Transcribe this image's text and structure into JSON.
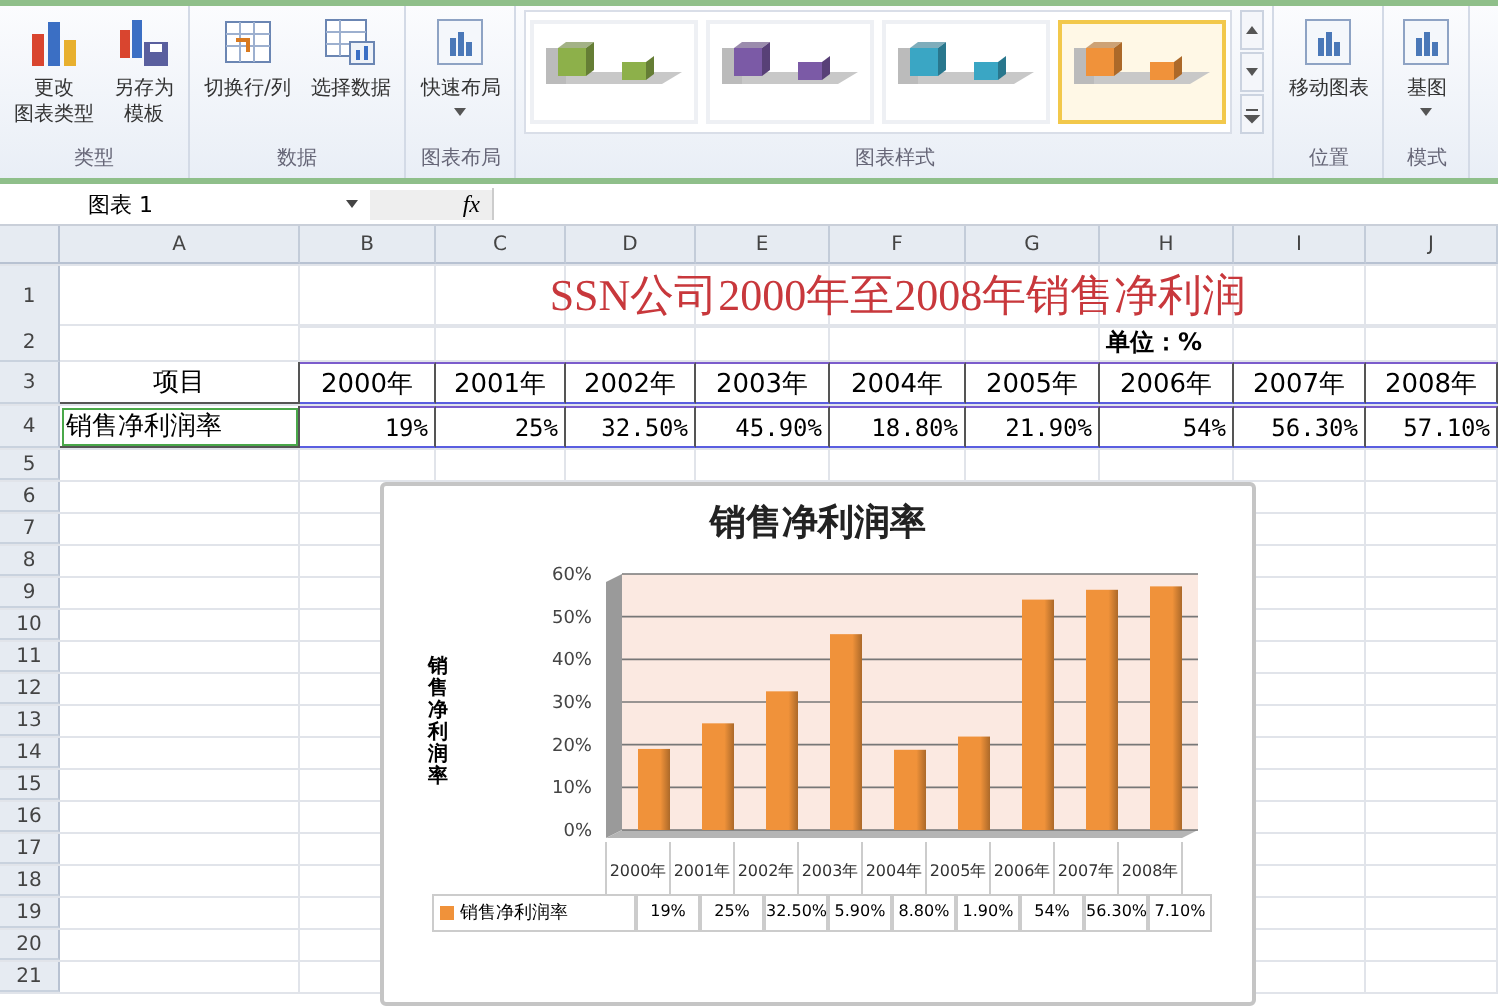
{
  "ribbon": {
    "groups": [
      {
        "label": "类型",
        "buttons": [
          {
            "kind": "chart-type",
            "lines": [
              "更改",
              "图表类型"
            ],
            "dropdown": false
          },
          {
            "kind": "template",
            "lines": [
              "另存为",
              "模板"
            ],
            "dropdown": false
          }
        ]
      },
      {
        "label": "数据",
        "buttons": [
          {
            "kind": "switch",
            "lines": [
              "切换行/列"
            ],
            "dropdown": false
          },
          {
            "kind": "select-data",
            "lines": [
              "选择数据"
            ],
            "dropdown": false
          }
        ]
      },
      {
        "label": "图表布局",
        "buttons": [
          {
            "kind": "layout",
            "lines": [
              "快速布局"
            ],
            "dropdown": true
          }
        ]
      },
      {
        "label": "图表样式",
        "styles": [
          {
            "color": "#8db04a",
            "selected": false
          },
          {
            "color": "#7b5aa6",
            "selected": false
          },
          {
            "color": "#3aa6c4",
            "selected": false
          },
          {
            "color": "#f0923a",
            "selected": true
          }
        ]
      },
      {
        "label": "位置",
        "buttons": [
          {
            "kind": "move",
            "lines": [
              "移动图表"
            ],
            "dropdown": false
          }
        ]
      },
      {
        "label": "模式",
        "buttons": [
          {
            "kind": "mode",
            "lines": [
              "基图"
            ],
            "dropdown": true
          }
        ]
      }
    ]
  },
  "formula_bar": {
    "name_box": "图表 1",
    "fx": "fx"
  },
  "sheet": {
    "columns": [
      "A",
      "B",
      "C",
      "D",
      "E",
      "F",
      "G",
      "H",
      "I",
      "J"
    ],
    "row_numbers": [
      "1",
      "2",
      "3",
      "4",
      "5",
      "6",
      "7",
      "8",
      "9",
      "10",
      "11",
      "12",
      "13",
      "14",
      "15",
      "16",
      "17",
      "18",
      "19",
      "20",
      "21"
    ],
    "title": "SSN公司2000年至2008年销售净利润",
    "unit": "单位：%",
    "header_label": "项目",
    "years": [
      "2000年",
      "2001年",
      "2002年",
      "2003年",
      "2004年",
      "2005年",
      "2006年",
      "2007年",
      "2008年"
    ],
    "row_label": "销售净利润率",
    "values": [
      "19%",
      "25%",
      "32.50%",
      "45.90%",
      "18.80%",
      "21.90%",
      "54%",
      "56.30%",
      "57.10%"
    ]
  },
  "chart": {
    "axis_title": "销售净利润率",
    "table_values": [
      "19%",
      "25%",
      "32.50%",
      "5.90%",
      "8.80%",
      "1.90%",
      "54%",
      "56.30%",
      "7.10%"
    ],
    "chart_data": {
      "type": "bar",
      "title": "销售净利润率",
      "categories": [
        "2000年",
        "2001年",
        "2002年",
        "2003年",
        "2004年",
        "2005年",
        "2006年",
        "2007年",
        "2008年"
      ],
      "series": [
        {
          "name": "销售净利润率",
          "color": "#f0923a",
          "values": [
            19,
            25,
            32.5,
            45.9,
            18.8,
            21.9,
            54,
            56.3,
            57.1
          ]
        }
      ],
      "ylim": [
        0,
        60
      ],
      "grid": true,
      "yticks": [
        {
          "value": 0,
          "label": "0%"
        },
        {
          "value": 10,
          "label": "10%"
        },
        {
          "value": 20,
          "label": "20%"
        },
        {
          "value": 30,
          "label": "30%"
        },
        {
          "value": 40,
          "label": "40%"
        },
        {
          "value": 50,
          "label": "50%"
        },
        {
          "value": 60,
          "label": "60%"
        }
      ]
    }
  }
}
